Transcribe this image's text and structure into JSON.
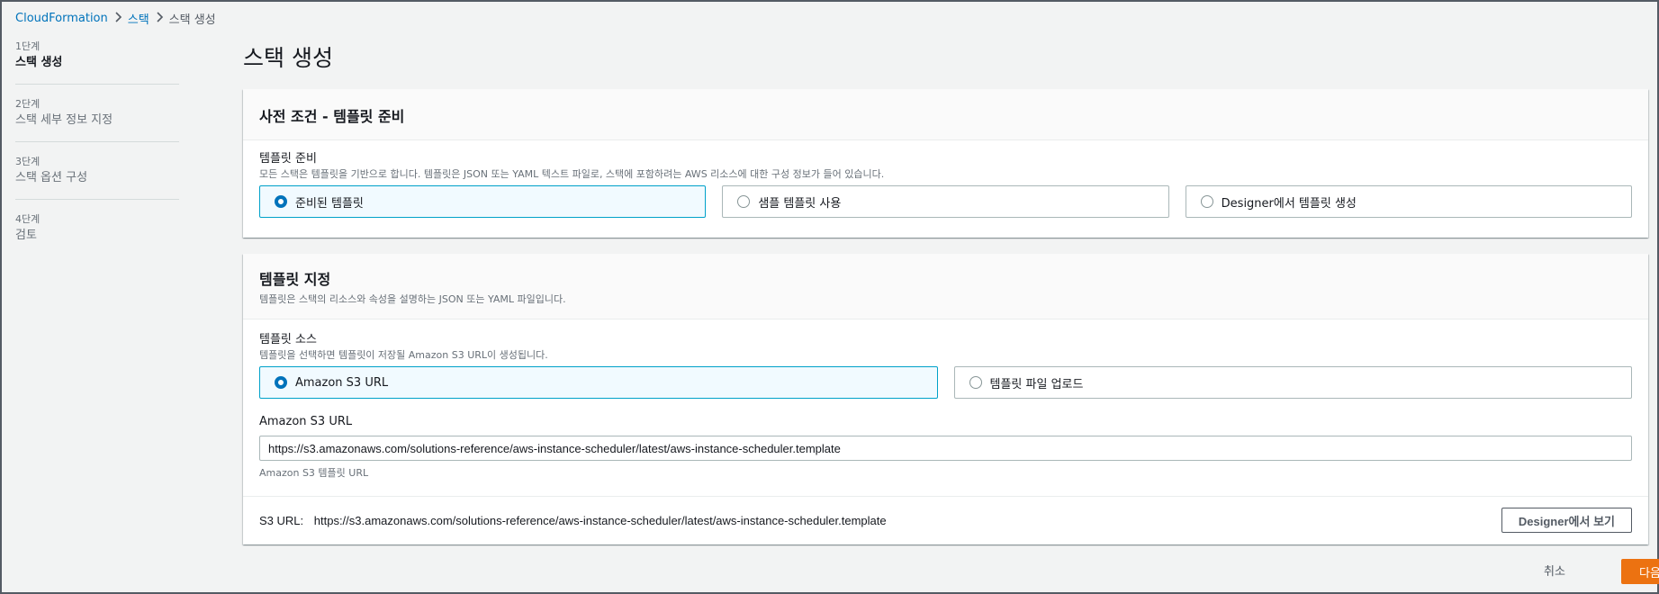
{
  "breadcrumb": {
    "root": "CloudFormation",
    "parent": "스택",
    "current": "스택 생성"
  },
  "steps": [
    {
      "num": "1단계",
      "label": "스택 생성",
      "active": true
    },
    {
      "num": "2단계",
      "label": "스택 세부 정보 지정"
    },
    {
      "num": "3단계",
      "label": "스택 옵션 구성"
    },
    {
      "num": "4단계",
      "label": "검토"
    }
  ],
  "page_title": "스택 생성",
  "prereq": {
    "title": "사전 조건 - 템플릿 준비",
    "field_label": "템플릿 준비",
    "field_desc": "모든 스택은 템플릿을 기반으로 합니다. 템플릿은 JSON 또는 YAML 텍스트 파일로, 스택에 포함하려는 AWS 리소스에 대한 구성 정보가 들어 있습니다.",
    "options": [
      "준비된 템플릿",
      "샘플 템플릿 사용",
      "Designer에서 템플릿 생성"
    ],
    "selected": "준비된 템플릿"
  },
  "specify": {
    "title": "템플릿 지정",
    "desc": "템플릿은 스택의 리소스와 속성을 설명하는 JSON 또는 YAML 파일입니다.",
    "source_label": "템플릿 소스",
    "source_desc": "템플릿을 선택하면 템플릿이 저장될 Amazon S3 URL이 생성됩니다.",
    "options": [
      "Amazon S3 URL",
      "템플릿 파일 업로드"
    ],
    "selected": "Amazon S3 URL",
    "url_label": "Amazon S3 URL",
    "url_value": "https://s3.amazonaws.com/solutions-reference/aws-instance-scheduler/latest/aws-instance-scheduler.template",
    "url_hint": "Amazon S3 템플릿 URL",
    "footer_label": "S3 URL:",
    "footer_value": "https://s3.amazonaws.com/solutions-reference/aws-instance-scheduler/latest/aws-instance-scheduler.template",
    "designer_button": "Designer에서 보기"
  },
  "actions": {
    "cancel": "취소",
    "next": "다음"
  },
  "colors": {
    "accent": "#0073bb",
    "primary": "#ec7211",
    "selected_tile_bg": "#f1faff",
    "selected_tile_border": "#00a1c9"
  }
}
